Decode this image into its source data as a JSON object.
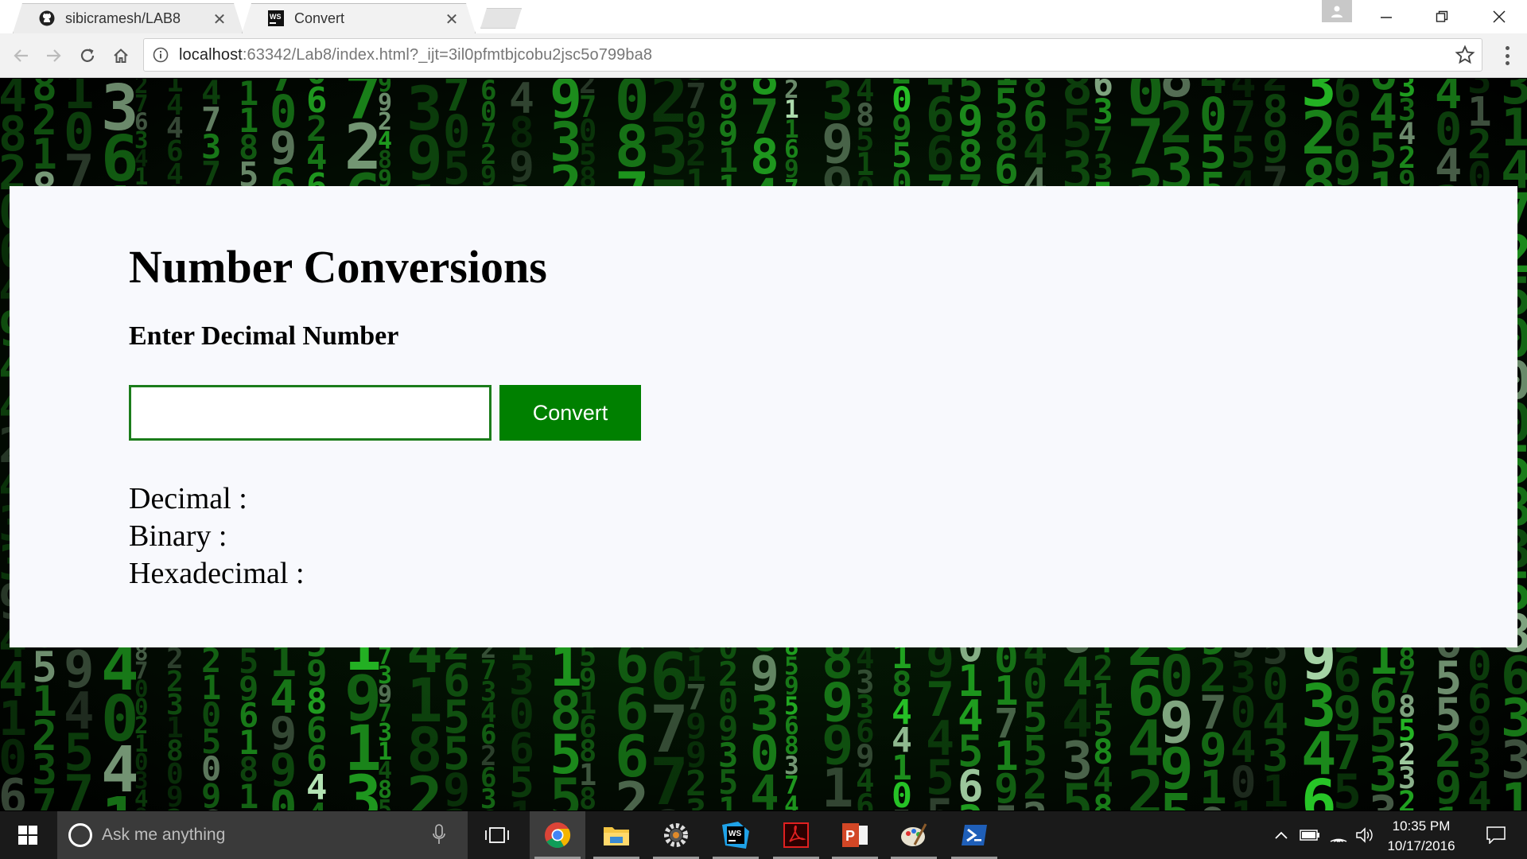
{
  "browser": {
    "tabs": [
      {
        "title": "sibicramesh/LAB8",
        "icon": "github-icon",
        "active": false
      },
      {
        "title": "Convert",
        "icon": "webstorm-icon",
        "active": true
      }
    ],
    "address": {
      "host": "localhost",
      "rest": ":63342/Lab8/index.html?_ijt=3il0pfmtbjcobu2jsc5o799ba8"
    }
  },
  "page": {
    "heading": "Number Conversions",
    "input_label": "Enter Decimal Number",
    "input_value": "",
    "convert_label": "Convert",
    "results": {
      "decimal_label": "Decimal :",
      "binary_label": "Binary :",
      "hex_label": "Hexadecimal :"
    }
  },
  "taskbar": {
    "search_placeholder": "Ask me anything",
    "time": "10:35 PM",
    "date": "10/17/2016",
    "apps": [
      "chrome-icon",
      "file-explorer-icon",
      "settings-gear-icon",
      "webstorm-icon",
      "acrobat-icon",
      "powerpoint-icon",
      "paint-icon",
      "powershell-icon"
    ]
  },
  "colors": {
    "accent_green": "#008000",
    "input_border": "#1b7c1b",
    "matrix_green": "#2bd62b",
    "panel_bg": "#f8f9fd"
  }
}
